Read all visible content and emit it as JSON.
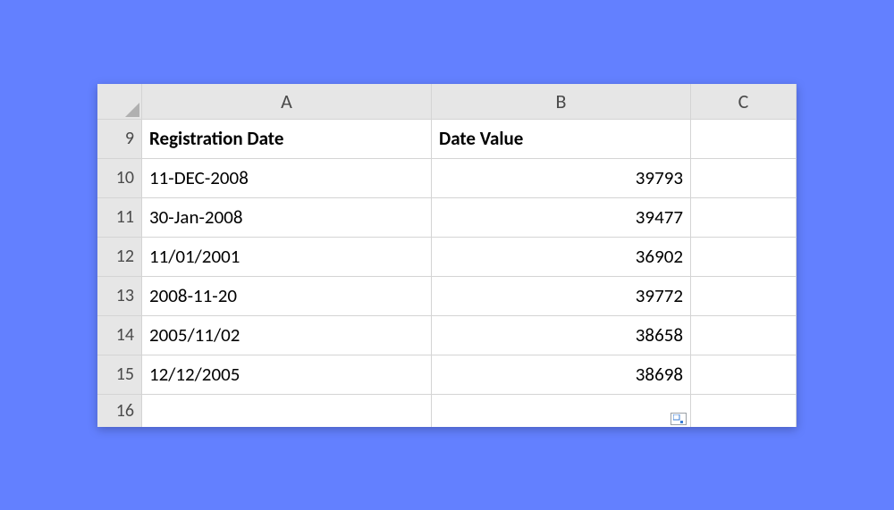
{
  "columns": {
    "A": "A",
    "B": "B",
    "C": "C"
  },
  "headerRow": {
    "num": "9",
    "A": "Registration Date",
    "B": "Date Value"
  },
  "rows": [
    {
      "num": "10",
      "A": "11-DEC-2008",
      "B": "39793"
    },
    {
      "num": "11",
      "A": "30-Jan-2008",
      "B": "39477"
    },
    {
      "num": "12",
      "A": "11/01/2001",
      "B": "36902"
    },
    {
      "num": "13",
      "A": "2008-11-20",
      "B": "39772"
    },
    {
      "num": "14",
      "A": "2005/11/02",
      "B": "38658"
    },
    {
      "num": "15",
      "A": "12/12/2005",
      "B": "38698"
    }
  ],
  "emptyRow": {
    "num": "16"
  }
}
